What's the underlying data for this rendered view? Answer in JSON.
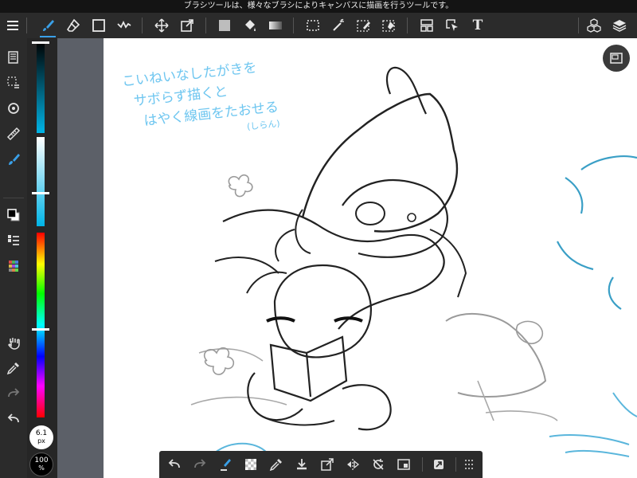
{
  "status_bar": {
    "hint": "ブラシツールは、様々なブラシによりキャンバスに描画を行うツールです。"
  },
  "toolbar": {
    "text_tool_label": "T",
    "active_color": "#3aa0e8"
  },
  "left_panel": {
    "brush_size_value": "6.1",
    "brush_size_unit": "px",
    "opacity_value": "100",
    "opacity_unit": "%"
  },
  "canvas": {
    "handwriting_lines": [
      "こいねいなしたがきを",
      "サボらず描くと",
      "はやく線画をたおせる",
      "(しらん)"
    ],
    "handwriting_color": "#6ec6f0"
  },
  "colors": {
    "primary": "#000000",
    "secondary": "#ffffff",
    "accent": "#3aa0e8",
    "slider_cyan": "#00b4e6"
  }
}
